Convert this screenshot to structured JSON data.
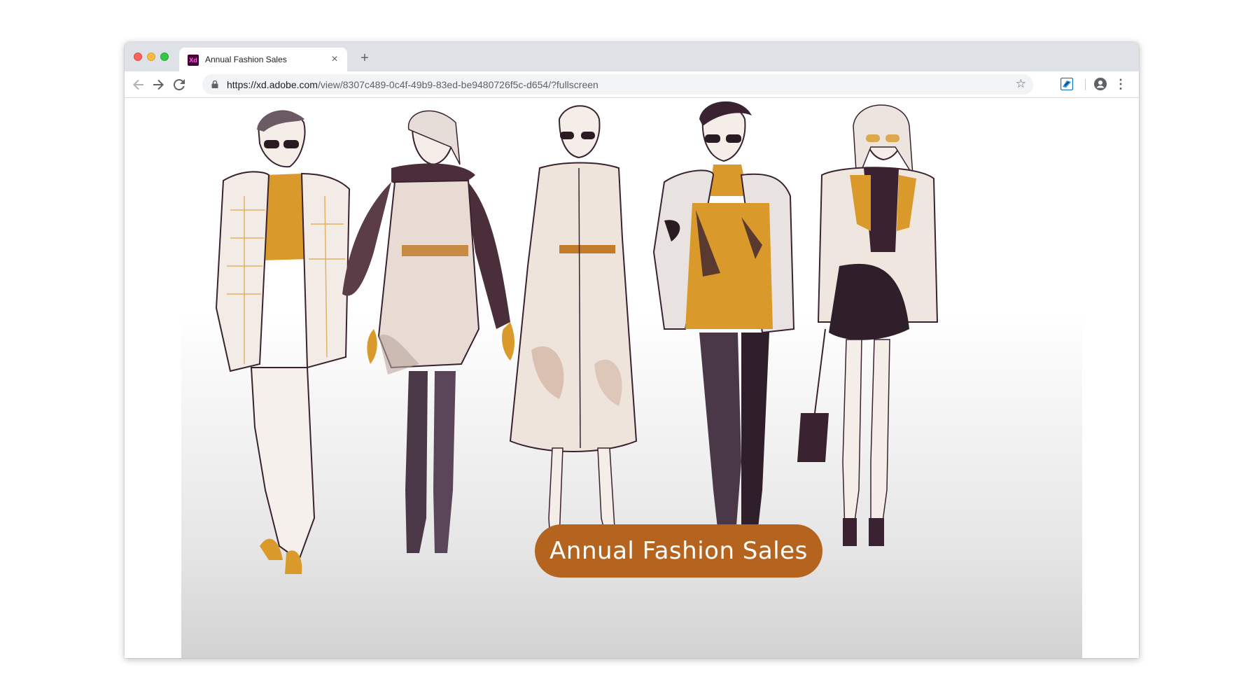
{
  "browser": {
    "tab": {
      "title": "Annual Fashion Sales",
      "favicon": "Xd",
      "favicon_icon": "adobe-xd-icon"
    },
    "new_tab_label": "+",
    "close_label": "×",
    "url": {
      "scheme_host": "https://xd.adobe.com",
      "path": "/view/8307c489-0c4f-49b9-83ed-be9480726f5c-d654/?fullscreen"
    },
    "icons": [
      "back-arrow-icon",
      "forward-arrow-icon",
      "reload-icon",
      "lock-icon",
      "star-icon",
      "extension-icon",
      "profile-icon",
      "menu-icon"
    ]
  },
  "prototype": {
    "illustration": "fashion-sketch-five-models",
    "cta_label": "Annual Fashion Sales",
    "colors": {
      "cta_background": "#b56420",
      "ink": "#3a2230",
      "accent": "#d99a2b",
      "skin_wash": "#c9a995"
    }
  }
}
